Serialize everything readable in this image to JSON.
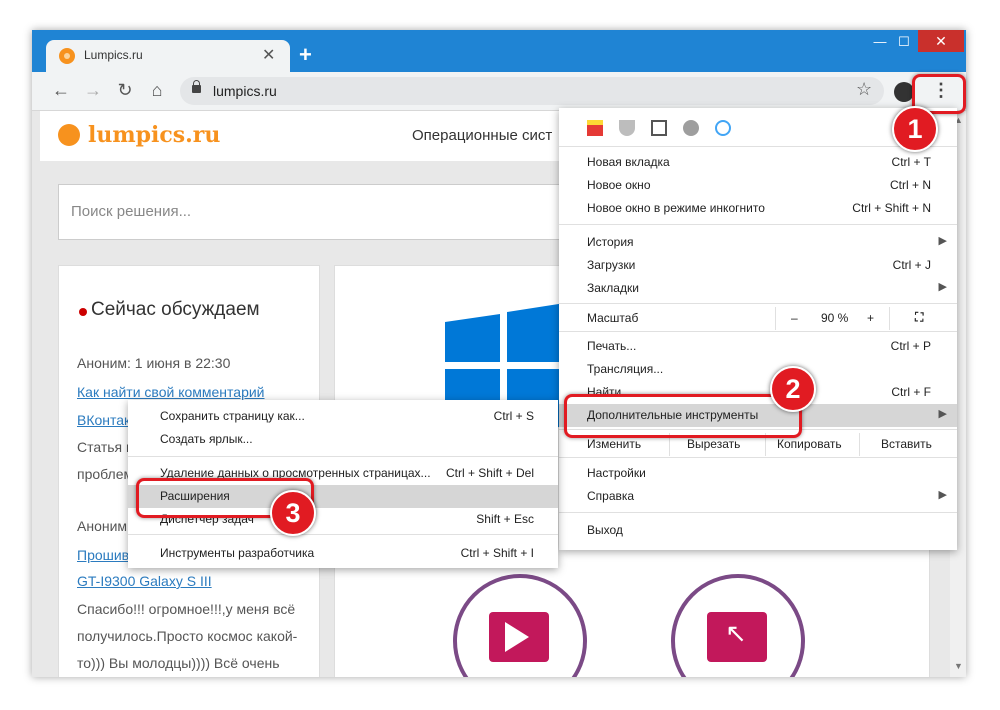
{
  "browser": {
    "tab_title": "Lumpics.ru",
    "url": "lumpics.ru",
    "new_tab": "+",
    "close_tab": "✕",
    "win_minimize": "—",
    "win_maximize": "☐",
    "win_close": "✕"
  },
  "site": {
    "logo": "lumpics.ru",
    "nav_os": "Операционные сист",
    "search_placeholder": "Поиск решения...",
    "discuss_title": "Сейчас обсуждаем",
    "comments": [
      "Аноним: 1 июня в 22:30",
      "Как найти свой комментарий",
      "ВКонтакте",
      "Статья н",
      "проблем",
      "Аноним",
      "Прошив",
      "GT-I9300 Galaxy S III",
      "Спасибо!!! огромное!!!,у меня всё",
      "получилось.Просто космос какой-",
      "то))) Вы молодцы)))) Всё очень"
    ]
  },
  "menu": {
    "items": [
      {
        "label": "Новая вкладка",
        "shortcut": "Ctrl + T"
      },
      {
        "label": "Новое окно",
        "shortcut": "Ctrl + N"
      },
      {
        "label": "Новое окно в режиме инкогнито",
        "shortcut": "Ctrl + Shift + N"
      },
      {
        "label": "История",
        "shortcut": ""
      },
      {
        "label": "Загрузки",
        "shortcut": "Ctrl + J"
      },
      {
        "label": "Закладки",
        "shortcut": ""
      },
      {
        "label": "Печать...",
        "shortcut": "Ctrl + P"
      },
      {
        "label": "Трансляция...",
        "shortcut": ""
      },
      {
        "label": "Найти...",
        "shortcut": "Ctrl + F"
      },
      {
        "label": "Дополнительные инструменты",
        "shortcut": ""
      },
      {
        "label": "Настройки",
        "shortcut": ""
      },
      {
        "label": "Справка",
        "shortcut": ""
      },
      {
        "label": "Выход",
        "shortcut": ""
      }
    ],
    "zoom": {
      "label": "Масштаб",
      "minus": "–",
      "value": "90 %",
      "plus": "+"
    },
    "edit": {
      "label": "Изменить",
      "cut": "Вырезать",
      "copy": "Копировать",
      "paste": "Вставить"
    }
  },
  "submenu": {
    "items": [
      {
        "label": "Сохранить страницу как...",
        "shortcut": "Ctrl + S"
      },
      {
        "label": "Создать ярлык...",
        "shortcut": ""
      },
      {
        "label": "Удаление данных о просмотренных страницах...",
        "shortcut": "Ctrl + Shift + Del"
      },
      {
        "label": "Расширения",
        "shortcut": ""
      },
      {
        "label": "Диспетчер задач",
        "shortcut": "Shift + Esc"
      },
      {
        "label": "Инструменты разработчика",
        "shortcut": "Ctrl + Shift + I"
      }
    ]
  },
  "annotations": {
    "step1": "1",
    "step2": "2",
    "step3": "3",
    "accent": "#e11b22"
  }
}
